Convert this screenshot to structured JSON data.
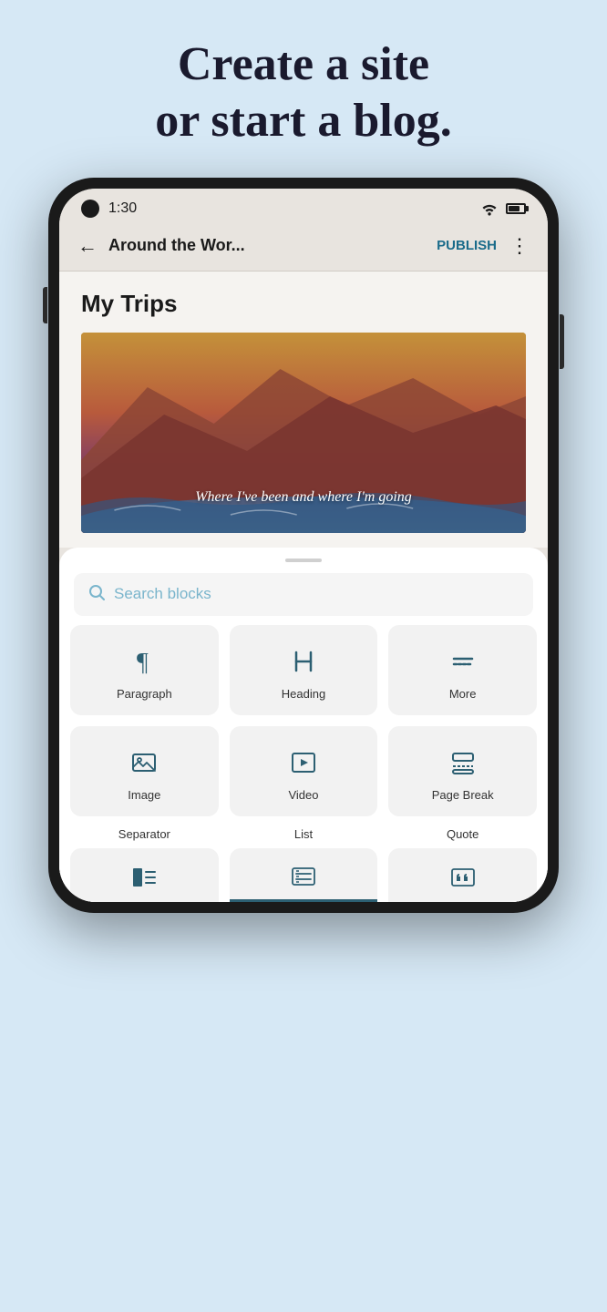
{
  "hero": {
    "line1": "Create a site",
    "line2": "or start a blog."
  },
  "statusBar": {
    "time": "1:30"
  },
  "topNav": {
    "title": "Around the Wor...",
    "publishLabel": "PUBLISH"
  },
  "editor": {
    "pageTitle": "My Trips",
    "heroCaption": "Where I've been and where I'm going"
  },
  "searchBar": {
    "placeholder": "Search blocks"
  },
  "blocks": [
    {
      "id": "paragraph",
      "label": "Paragraph",
      "icon": "paragraph"
    },
    {
      "id": "heading",
      "label": "Heading",
      "icon": "heading"
    },
    {
      "id": "more",
      "label": "More",
      "icon": "more"
    },
    {
      "id": "image",
      "label": "Image",
      "icon": "image"
    },
    {
      "id": "video",
      "label": "Video",
      "icon": "video"
    },
    {
      "id": "pagebreak",
      "label": "Page Break",
      "icon": "pagebreak"
    }
  ],
  "bottomBlocks": [
    {
      "id": "separator",
      "label": "Separator",
      "icon": "separator"
    },
    {
      "id": "list",
      "label": "List",
      "icon": "list"
    },
    {
      "id": "quote",
      "label": "Quote",
      "icon": "quote"
    }
  ]
}
